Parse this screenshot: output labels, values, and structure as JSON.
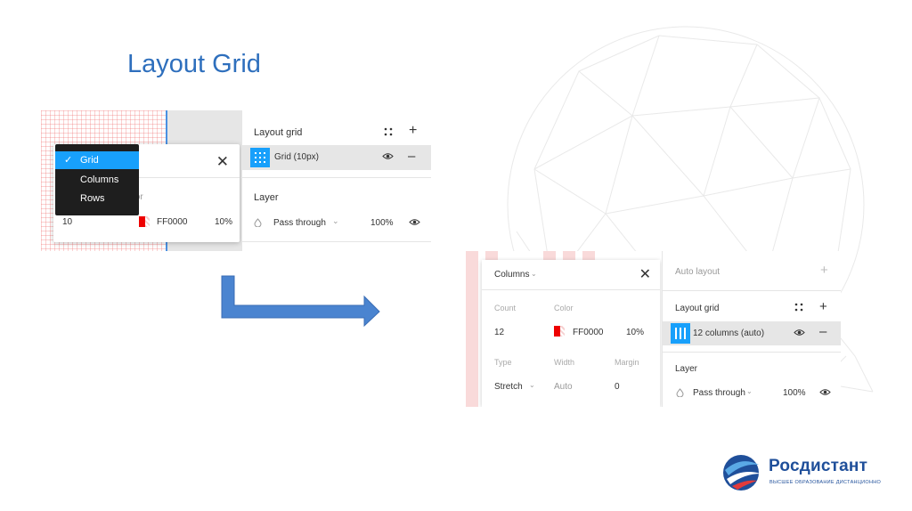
{
  "slide": {
    "title": "Layout Grid"
  },
  "screenshot_before": {
    "dropdown_items": [
      {
        "label": "Grid",
        "selected": true
      },
      {
        "label": "Columns",
        "selected": false
      },
      {
        "label": "Rows",
        "selected": false
      }
    ],
    "checkmark": "✓",
    "color_label": "olor",
    "size_value": "10",
    "color_hex": "FF0000",
    "opacity": "10%",
    "close_glyph": "✕",
    "panel": {
      "title": "Layout grid",
      "grid_row_label": "Grid (10px)",
      "layer_title": "Layer",
      "blend_mode": "Pass through",
      "layer_opacity": "100%"
    }
  },
  "screenshot_after": {
    "popup": {
      "type_label": "Columns",
      "count_label": "Count",
      "color_label": "Color",
      "count_value": "12",
      "color_hex": "FF0000",
      "opacity": "10%",
      "type_field_label": "Type",
      "width_label": "Width",
      "margin_label": "Margin",
      "type_value": "Stretch",
      "width_value": "Auto",
      "margin_value": "0"
    },
    "panel": {
      "auto_layout": "Auto layout",
      "layout_grid_title": "Layout grid",
      "grid_row_label": "12 columns (auto)",
      "layer_title": "Layer",
      "blend_mode": "Pass through",
      "layer_opacity": "100%"
    }
  },
  "logo": {
    "name": "Росдистант",
    "tagline": "ВЫСШЕЕ ОБРАЗОВАНИЕ ДИСТАНЦИОННО"
  },
  "colors": {
    "accent": "#18a0fb",
    "grid_red": "#ee0000",
    "title_blue": "#2e6fbd",
    "logo_blue": "#1f4f9a"
  }
}
